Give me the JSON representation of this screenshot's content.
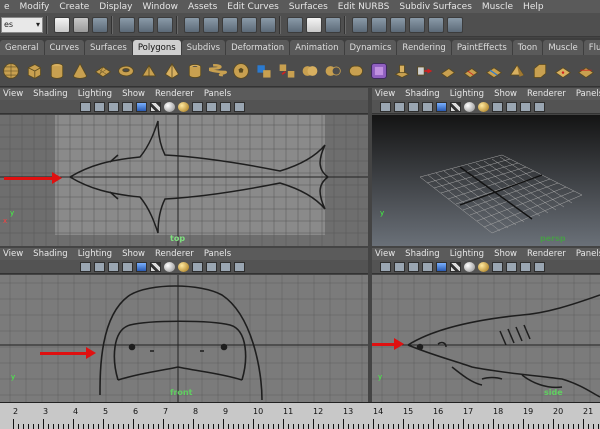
{
  "menubar": [
    "e",
    "Modify",
    "Create",
    "Display",
    "Window",
    "Assets",
    "Edit Curves",
    "Surfaces",
    "Edit NURBS",
    "Subdiv Surfaces",
    "Muscle",
    "Help"
  ],
  "status": {
    "mode_value": "es"
  },
  "shelf_tabs": [
    {
      "label": "General",
      "active": false
    },
    {
      "label": "Curves",
      "active": false
    },
    {
      "label": "Surfaces",
      "active": false
    },
    {
      "label": "Polygons",
      "active": true
    },
    {
      "label": "Subdivs",
      "active": false
    },
    {
      "label": "Deformation",
      "active": false
    },
    {
      "label": "Animation",
      "active": false
    },
    {
      "label": "Dynamics",
      "active": false
    },
    {
      "label": "Rendering",
      "active": false
    },
    {
      "label": "PaintEffects",
      "active": false
    },
    {
      "label": "Toon",
      "active": false
    },
    {
      "label": "Muscle",
      "active": false
    },
    {
      "label": "Fluids",
      "active": false
    }
  ],
  "viewport_menu": [
    "View",
    "Shading",
    "Lighting",
    "Show",
    "Renderer",
    "Panels"
  ],
  "viewports": {
    "top": {
      "label": "top"
    },
    "persp": {
      "label": "persp"
    },
    "front": {
      "label": "front"
    },
    "side": {
      "label": "side"
    }
  },
  "timeline": {
    "ticks": [
      "2",
      "3",
      "4",
      "5",
      "6",
      "7",
      "8",
      "9",
      "10",
      "11",
      "12",
      "13",
      "14",
      "15",
      "16",
      "17",
      "18",
      "19",
      "20",
      "21"
    ]
  },
  "colors": {
    "accent_arrow": "#e01010",
    "grid_bg": "#7d7d7d",
    "persp_bg_top": "#141414",
    "persp_bg_bottom": "#6a7078"
  }
}
